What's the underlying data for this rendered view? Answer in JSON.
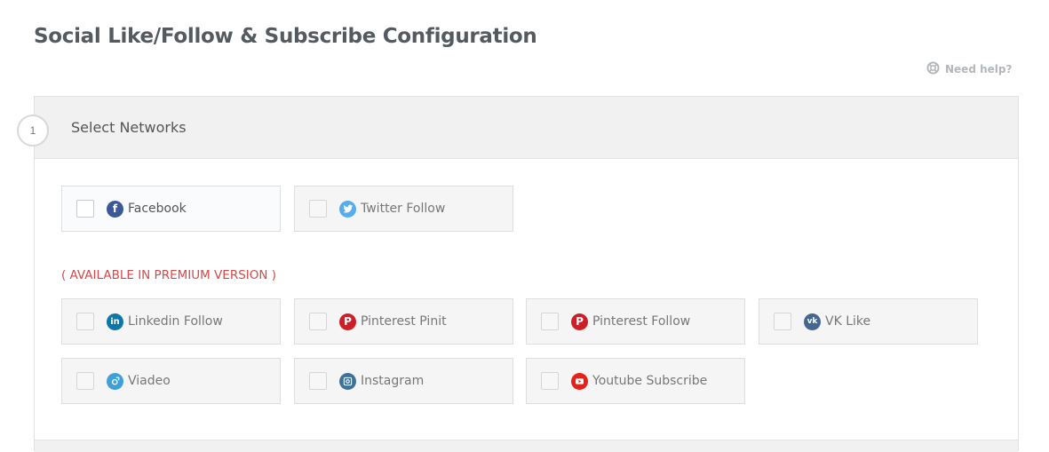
{
  "page": {
    "title": "Social Like/Follow & Subscribe Configuration",
    "help_label": "Need help?"
  },
  "step": {
    "number": "1",
    "title": "Select Networks"
  },
  "free_networks": [
    {
      "label": "Facebook",
      "icon": "facebook-icon",
      "color": "#3b5998",
      "checked": false,
      "enabled": true
    },
    {
      "label": "Twitter Follow",
      "icon": "twitter-icon",
      "color": "#55acee",
      "checked": false,
      "enabled": false
    }
  ],
  "premium_note": "( AVAILABLE IN PREMIUM VERSION )",
  "premium_networks": [
    {
      "label": "Linkedin Follow",
      "icon": "linkedin-icon",
      "color": "#0e76a8",
      "checked": false
    },
    {
      "label": "Pinterest Pinit",
      "icon": "pinterest-icon",
      "color": "#cb2027",
      "checked": false
    },
    {
      "label": "Pinterest Follow",
      "icon": "pinterest-icon",
      "color": "#cb2027",
      "checked": false
    },
    {
      "label": "VK Like",
      "icon": "vk-icon",
      "color": "#45668e",
      "checked": false
    },
    {
      "label": "Viadeo",
      "icon": "viadeo-icon",
      "color": "#3fa0d8",
      "checked": false
    },
    {
      "label": "Instagram",
      "icon": "instagram-icon",
      "color": "#3f729b",
      "checked": false
    },
    {
      "label": "Youtube Subscribe",
      "icon": "youtube-icon",
      "color": "#e62117",
      "checked": false
    }
  ]
}
